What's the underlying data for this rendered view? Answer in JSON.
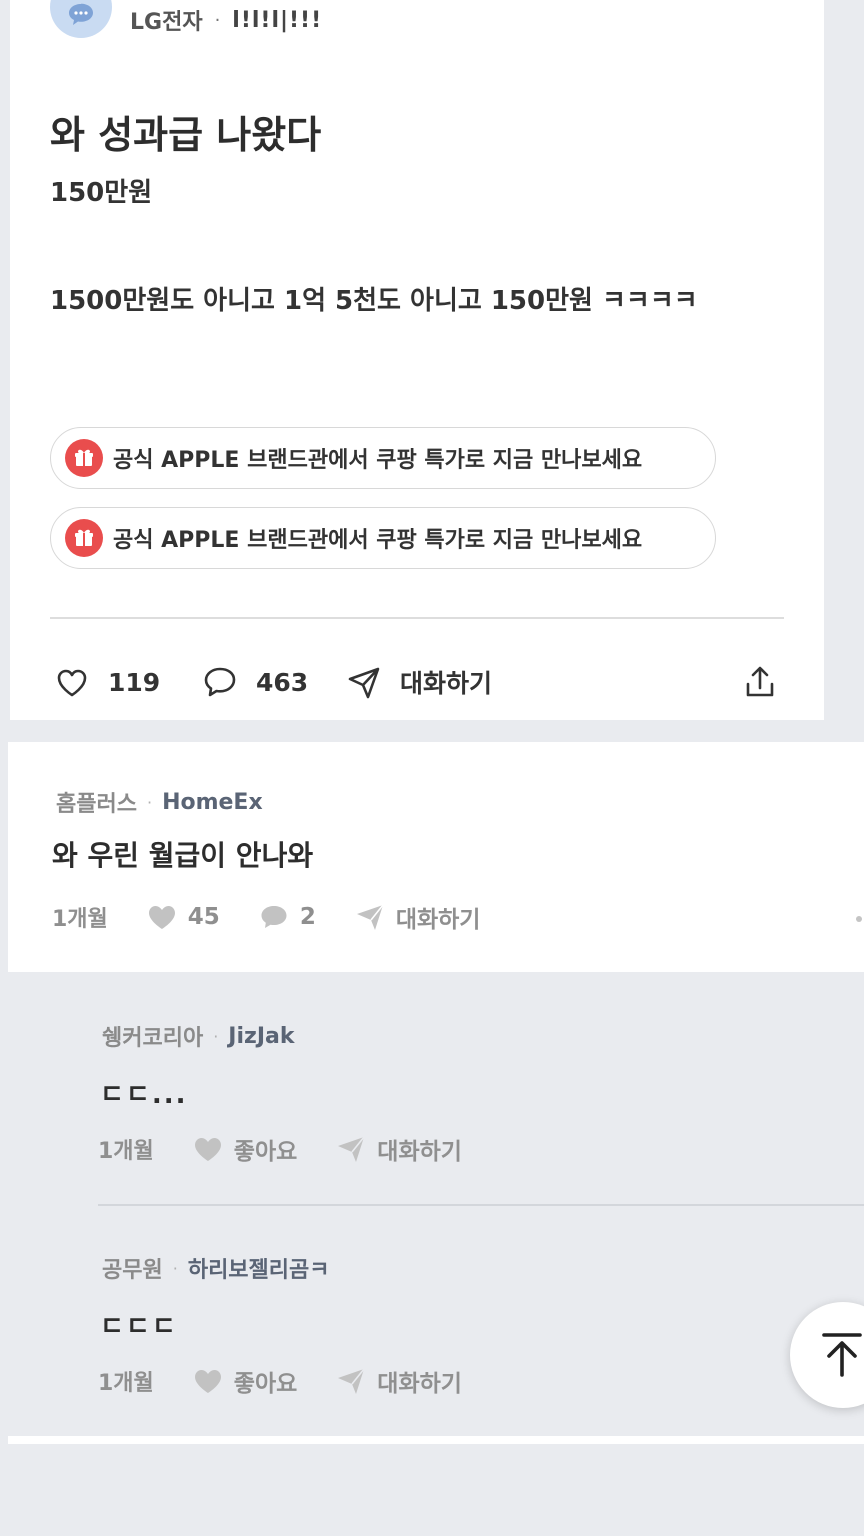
{
  "post": {
    "company": "LG전자",
    "separator": "·",
    "nickname": "l!l!l|!!!",
    "title": "와 성과급 나왔다",
    "subtitle": "150만원",
    "body": "1500만원도 아니고 1억 5천도 아니고 150만원 ㅋㅋㅋㅋ",
    "promos": [
      {
        "text": "공식 APPLE 브랜드관에서 쿠팡 특가로 지금 만나보세요",
        "icon": "gift-icon"
      },
      {
        "text": "공식 APPLE 브랜드관에서 쿠팡 특가로 지금 만나보세요",
        "icon": "gift-icon"
      }
    ],
    "actions": {
      "likes": "119",
      "comments": "463",
      "chat_label": "대화하기"
    }
  },
  "comment": {
    "company": "홈플러스",
    "separator": "·",
    "nickname": "HomeEx",
    "text": "와 우린 월급이 안나와",
    "age": "1개월",
    "likes": "45",
    "comments": "2",
    "chat_label": "대화하기"
  },
  "replies": [
    {
      "company": "쉥커코리아",
      "separator": "·",
      "nickname": "JizJak",
      "text": "ㄷㄷ...",
      "age": "1개월",
      "like_label": "좋아요",
      "chat_label": "대화하기"
    },
    {
      "company": "공무원",
      "separator": "·",
      "nickname": "하리보젤리곰ㅋ",
      "text": "ㄷㄷㄷ",
      "age": "1개월",
      "like_label": "좋아요",
      "chat_label": "대화하기"
    }
  ],
  "colors": {
    "gift_badge": "#e94d4d",
    "avatar_bg": "#c9dbf2",
    "muted_icon": "#c2c2c2"
  }
}
